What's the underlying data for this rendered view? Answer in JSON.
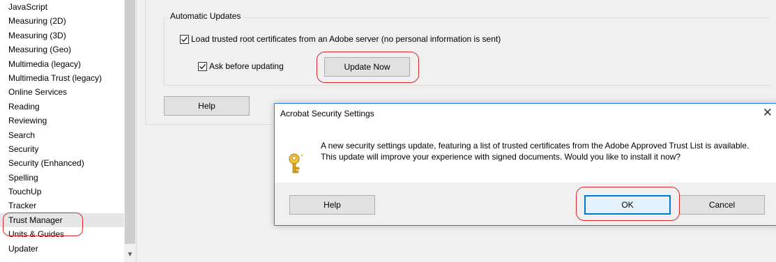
{
  "category_list": {
    "items": [
      "JavaScript",
      "Measuring (2D)",
      "Measuring (3D)",
      "Measuring (Geo)",
      "Multimedia (legacy)",
      "Multimedia Trust (legacy)",
      "Online Services",
      "Reading",
      "Reviewing",
      "Search",
      "Security",
      "Security (Enhanced)",
      "Spelling",
      "TouchUp",
      "Tracker",
      "Trust Manager",
      "Units & Guides",
      "Updater"
    ],
    "selected": "Trust Manager"
  },
  "automatic_updates": {
    "title": "Automatic Updates",
    "load_trusted_label": "Load trusted root certificates from an Adobe server (no personal information is sent)",
    "load_trusted_checked": true,
    "ask_before_label": "Ask before updating",
    "ask_before_checked": true,
    "update_now_label": "Update Now"
  },
  "help_label": "Help",
  "dialog": {
    "title": "Acrobat Security Settings",
    "close_glyph": "✕",
    "message": "A new security settings update, featuring a list of trusted certificates from the Adobe Approved Trust List is available.  This update will improve your experience with signed documents.  Would you like to install it now?",
    "help_label": "Help",
    "ok_label": "OK",
    "cancel_label": "Cancel",
    "icon": "key-icon"
  },
  "colors": {
    "highlight_ring": "#e0242b",
    "dialog_border": "#2b80d8",
    "default_button_border": "#0078d7"
  }
}
